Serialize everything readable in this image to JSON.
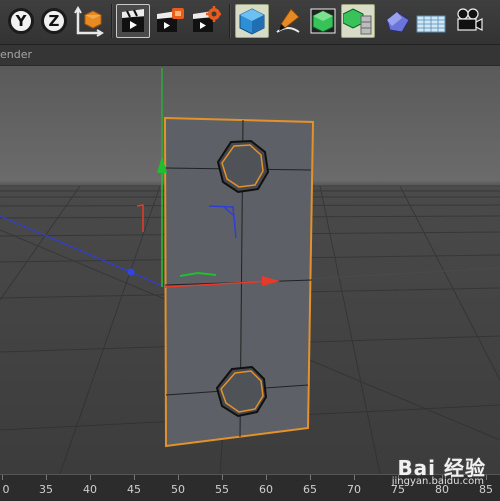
{
  "toolbar": {
    "axis_y": "Y",
    "axis_z": "Z",
    "buttons": [
      "coordinate-system-icon",
      "render-view-icon",
      "render-to-picture-viewer-icon",
      "render-settings-icon",
      "cube-primitive-icon",
      "pen-spline-icon",
      "subdivision-surface-icon",
      "array-icon",
      "deformer-icon",
      "floor-icon",
      "camera-icon"
    ]
  },
  "menubar": {
    "label": "ender"
  },
  "timeline": {
    "ticks": [
      "0",
      "35",
      "40",
      "45",
      "50",
      "55",
      "60",
      "65",
      "70",
      "75",
      "80",
      "85"
    ]
  },
  "watermark": {
    "brand": "Bai 经验",
    "site": "jingyan.baidu.com"
  },
  "colors": {
    "selection_outline": "#e3922b",
    "object_fill": "#5d6066",
    "axis_x": "#e53b2a",
    "axis_y": "#1fbf2e",
    "axis_z": "#2f3ed6"
  }
}
